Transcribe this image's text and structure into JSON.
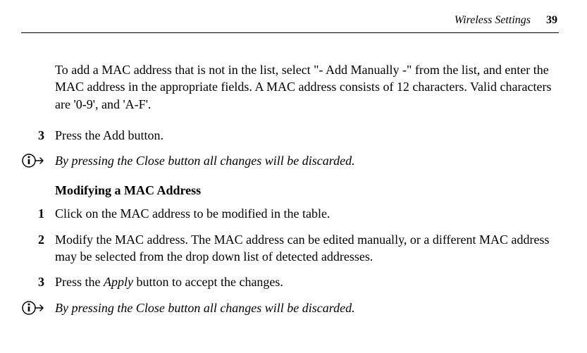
{
  "header": {
    "title": "Wireless Settings",
    "page_number": "39"
  },
  "intro_paragraph": "To add a MAC address that is not in the list, select \"- Add Manually -\" from the list, and enter the MAC address in the appropriate fields. A MAC address consists of 12 characters. Valid characters are '0-9', and 'A-F'.",
  "step_add_3": {
    "num": "3",
    "text": "Press the Add button."
  },
  "info_note_1": "By pressing the Close button all changes will be discarded.",
  "section_heading": "Modifying a MAC Address",
  "modify_steps": {
    "s1": {
      "num": "1",
      "text": "Click on the MAC address to be modified in the table."
    },
    "s2": {
      "num": "2",
      "text": "Modify the MAC address. The MAC address can be edited manually, or a different MAC address may be selected from the drop down list of detected addresses."
    },
    "s3": {
      "num": "3",
      "prefix": "Press the ",
      "apply": "Apply",
      "suffix": " button to accept the changes."
    }
  },
  "info_note_2": "By pressing the Close button all changes will be discarded."
}
